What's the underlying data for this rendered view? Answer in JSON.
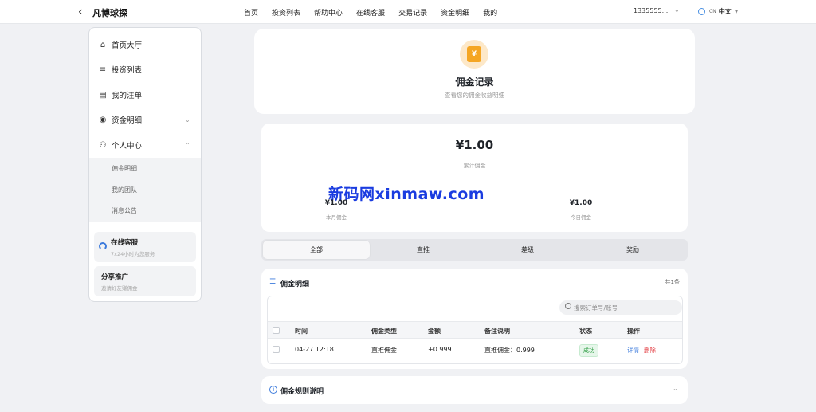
{
  "header": {
    "back_icon": "chevron-left-icon",
    "brand": "凡博球探",
    "nav": [
      "首页",
      "投资列表",
      "帮助中心",
      "在线客服",
      "交易记录",
      "资金明细",
      "我的"
    ],
    "account": "1335555...",
    "lang_code": "CN",
    "lang_label": "中文"
  },
  "sidebar": {
    "items": [
      {
        "icon": "home-icon",
        "label": "首页大厅"
      },
      {
        "icon": "list-icon",
        "label": "投资列表"
      },
      {
        "icon": "document-icon",
        "label": "我的注单"
      },
      {
        "icon": "coin-icon",
        "label": "资金明细"
      },
      {
        "icon": "user-icon",
        "label": "个人中心"
      }
    ],
    "sub_items": [
      "佣金明细",
      "我的团队",
      "消息公告"
    ],
    "support": {
      "title": "在线客服",
      "subtitle": "7x24小时为您服务"
    },
    "share": {
      "title": "分享推广",
      "subtitle": "邀请好友赚佣金"
    }
  },
  "title_card": {
    "icon": "yen-envelope-icon",
    "title": "佣金记录",
    "subtitle": "查看您的佣金收益明细"
  },
  "stats": {
    "total_value": "¥1.00",
    "total_label": "累计佣金",
    "month_value": "¥1.00",
    "month_label": "本月佣金",
    "today_value": "¥1.00",
    "today_label": "今日佣金",
    "watermark": "新码网xinmaw.com"
  },
  "tabs": [
    "全部",
    "直推",
    "差级",
    "奖励"
  ],
  "active_tab": 0,
  "detail": {
    "title": "佣金明细",
    "count": "共1条",
    "search_placeholder": "搜索订单号/账号",
    "columns": [
      "时间",
      "佣金类型",
      "金额",
      "备注说明",
      "状态",
      "操作"
    ],
    "rows": [
      {
        "time": "04-27 12:18",
        "type": "直推佣金",
        "amount": "+0.999",
        "note": "直推佣金：0.999",
        "status": "成功",
        "action_detail": "详情",
        "action_delete": "删除"
      }
    ]
  },
  "rules": {
    "title": "佣金规则说明"
  },
  "colors": {
    "accent": "#3d7bdc",
    "success": "#2f9e44",
    "danger": "#e5484d",
    "coin": "#f5a623",
    "watermark": "#1a3ce0"
  }
}
